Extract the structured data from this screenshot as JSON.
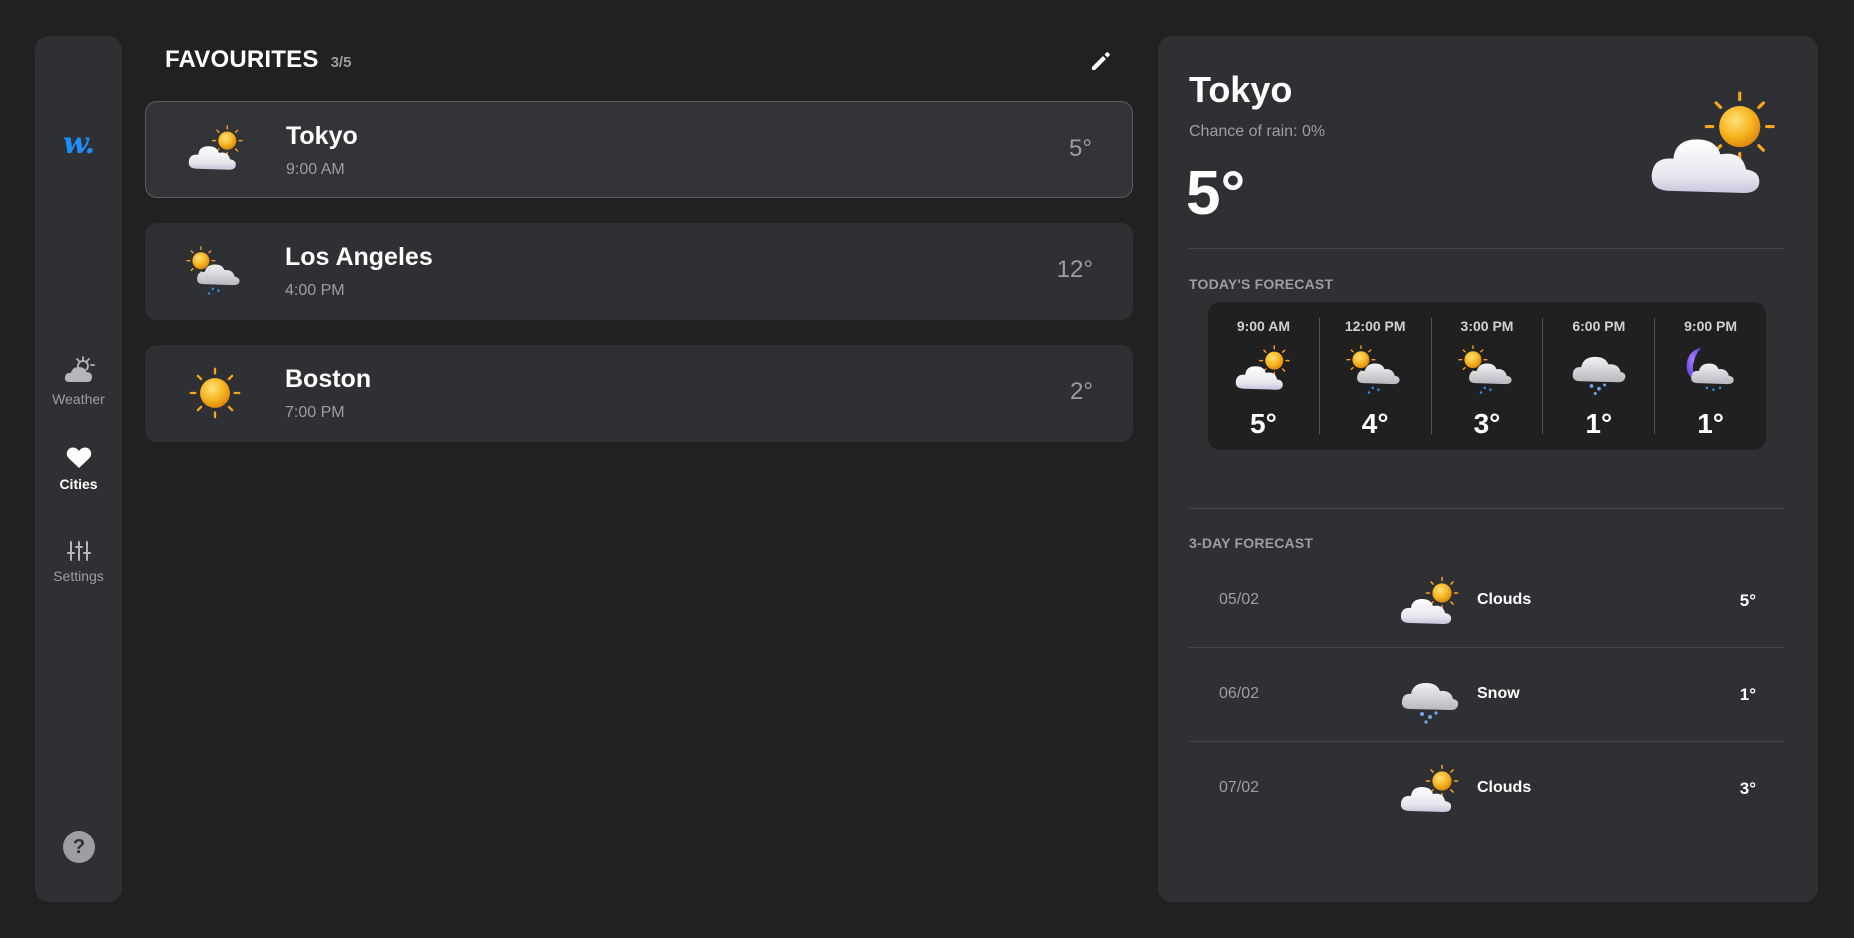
{
  "app": {
    "logo_text": "w."
  },
  "nav": [
    {
      "label": "Weather",
      "icon": "partly-cloudy-icon",
      "active": false
    },
    {
      "label": "Cities",
      "icon": "heart-icon",
      "active": true
    },
    {
      "label": "Settings",
      "icon": "sliders-icon",
      "active": false
    }
  ],
  "help": {
    "label": "?"
  },
  "favourites": {
    "title": "FAVOURITES",
    "count": "3/5",
    "edit_icon": "pencil-icon",
    "cities": [
      {
        "name": "Tokyo",
        "time": "9:00 AM",
        "temp": "5°",
        "icon": "sun-behind-cloud-icon",
        "selected": true
      },
      {
        "name": "Los Angeles",
        "time": "4:00 PM",
        "temp": "12°",
        "icon": "sun-cloud-rain-icon",
        "selected": false
      },
      {
        "name": "Boston",
        "time": "7:00 PM",
        "temp": "2°",
        "icon": "sun-icon",
        "selected": false
      }
    ]
  },
  "detail": {
    "city": "Tokyo",
    "rain": "Chance of rain: 0%",
    "temp": "5°",
    "icon": "sun-behind-cloud-icon",
    "today_title": "TODAY'S FORECAST",
    "hourly": [
      {
        "time": "9:00 AM",
        "temp": "5°",
        "icon": "sun-behind-cloud-icon"
      },
      {
        "time": "12:00 PM",
        "temp": "4°",
        "icon": "sun-cloud-rain-icon"
      },
      {
        "time": "3:00 PM",
        "temp": "3°",
        "icon": "sun-cloud-rain-icon"
      },
      {
        "time": "6:00 PM",
        "temp": "1°",
        "icon": "cloud-snow-icon"
      },
      {
        "time": "9:00 PM",
        "temp": "1°",
        "icon": "moon-cloud-rain-icon"
      }
    ],
    "three_day_title": "3-DAY FORECAST",
    "days": [
      {
        "date": "05/02",
        "condition": "Clouds",
        "temp": "5°",
        "icon": "sun-behind-cloud-icon"
      },
      {
        "date": "06/02",
        "condition": "Snow",
        "temp": "1°",
        "icon": "cloud-snow-icon"
      },
      {
        "date": "07/02",
        "condition": "Clouds",
        "temp": "3°",
        "icon": "sun-behind-cloud-icon"
      }
    ]
  },
  "colors": {
    "background": "#212121",
    "panel": "#2f3034",
    "accent": "#1e8fff",
    "muted_text": "#9c9ea4",
    "sun": "#f7b521"
  }
}
